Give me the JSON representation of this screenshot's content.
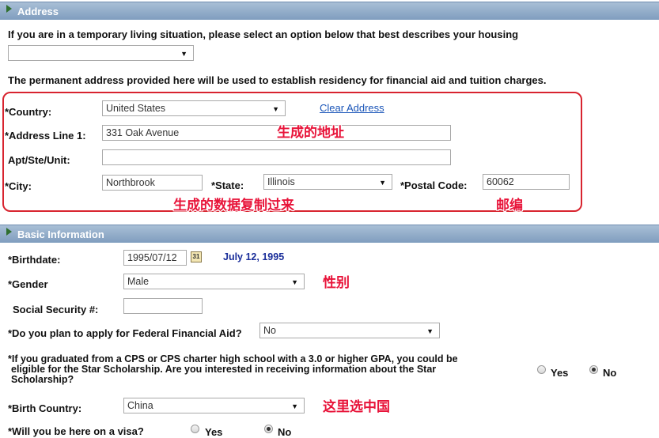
{
  "address_section": {
    "title": "Address",
    "housing_question": "If you are in a temporary living situation, please select an option below that best describes your housing",
    "housing_value": "",
    "permanent_note": "The permanent address provided here will be used to establish residency for financial aid and tuition charges.",
    "country_label": "*Country:",
    "country_value": "United States",
    "clear_address": "Clear Address",
    "address1_label": "*Address Line 1:",
    "address1_value": "331 Oak Avenue",
    "apt_label": "Apt/Ste/Unit:",
    "apt_value": "",
    "city_label": "*City:",
    "city_value": "Northbrook",
    "state_label": "*State:",
    "state_value": "Illinois",
    "postal_label": "*Postal Code:",
    "postal_value": "60062"
  },
  "annotations": {
    "generated_address": "生成的地址",
    "copy_data": "生成的数据复制过来",
    "postal_code": "邮编",
    "gender": "性别",
    "choose_china": "这里选中国"
  },
  "basic_section": {
    "title": "Basic Information",
    "birthdate_label": "*Birthdate:",
    "birthdate_value": "1995/07/12",
    "birthdate_display": "July 12, 1995",
    "gender_label": "*Gender",
    "gender_value": "Male",
    "ssn_label": "Social Security #:",
    "ssn_value": "",
    "ffa_label": "*Do you plan to apply for Federal Financial Aid?",
    "ffa_value": "No",
    "star_line1": "*If you graduated from a CPS or CPS charter high school with a 3.0 or higher GPA, you could be",
    "star_line2": "eligible for the Star Scholarship. Are you interested in receiving information about the Star",
    "star_line3": "Scholarship?",
    "star_yes": "Yes",
    "star_no": "No",
    "birth_country_label": "*Birth Country:",
    "birth_country_value": "China",
    "visa_label": "*Will you be here on a visa?",
    "visa_yes": "Yes",
    "visa_no": "No"
  },
  "icons": {
    "calendar": "calendar-icon",
    "dropdown": "chevron-down-icon",
    "section": "triangle-right-icon"
  },
  "colors": {
    "header": "#8aa6c4",
    "annotation": "#e8143a",
    "link": "#1a55b8",
    "highlight_box": "#d8242f"
  }
}
